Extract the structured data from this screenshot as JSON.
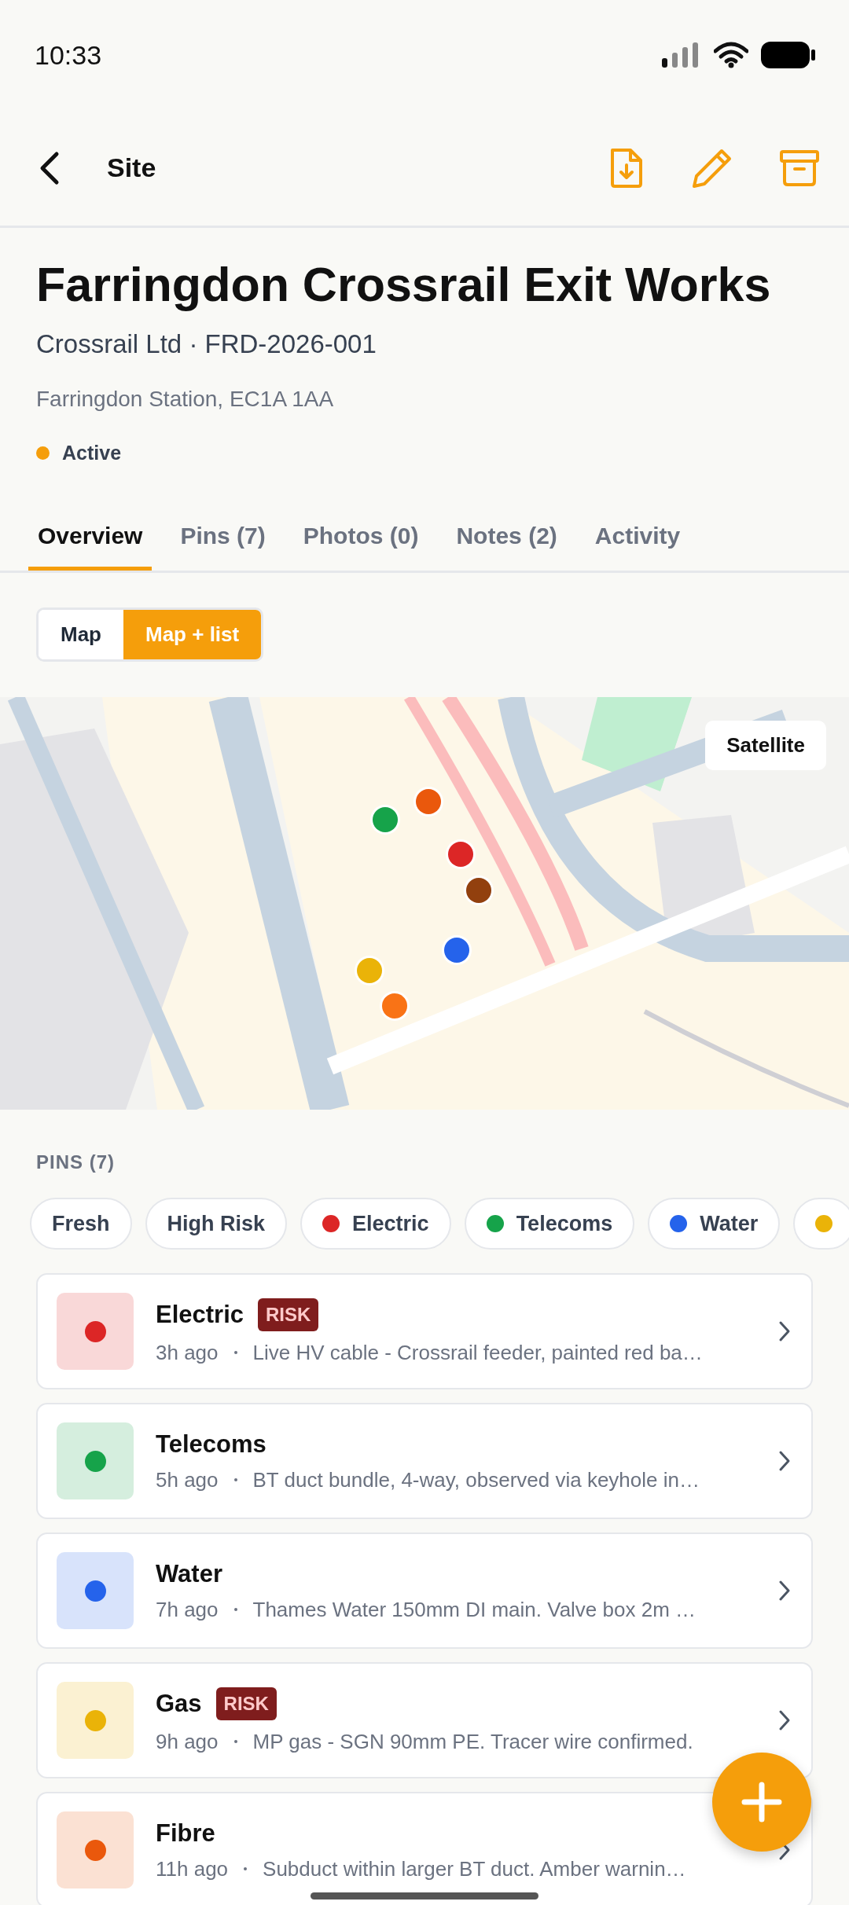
{
  "status_bar": {
    "time": "10:33"
  },
  "header": {
    "title": "Site"
  },
  "site": {
    "name": "Farringdon Crossrail Exit Works",
    "client": "Crossrail Ltd · FRD-2026-001",
    "address": "Farringdon Station, EC1A 1AA",
    "status": "Active"
  },
  "tabs": [
    {
      "label": "Overview",
      "selected": true
    },
    {
      "label": "Pins (7)",
      "selected": false
    },
    {
      "label": "Photos (0)",
      "selected": false
    },
    {
      "label": "Notes (2)",
      "selected": false
    },
    {
      "label": "Activity",
      "selected": false
    }
  ],
  "view_toggle": [
    {
      "label": "Map",
      "selected": false
    },
    {
      "label": "Map + list",
      "selected": true
    }
  ],
  "map": {
    "kind": "picture",
    "satellite_button": "Satellite",
    "markers": [
      {
        "color": "#16a34a"
      },
      {
        "color": "#ea580c"
      },
      {
        "color": "#dc2626"
      },
      {
        "color": "#92400e"
      },
      {
        "color": "#2563eb"
      },
      {
        "color": "#eab308"
      },
      {
        "color": "#f97316"
      }
    ]
  },
  "pins_heading": "PINS (7)",
  "filters": [
    {
      "label": "Fresh"
    },
    {
      "label": "High Risk"
    },
    {
      "label": "Electric",
      "color": "#dc2626"
    },
    {
      "label": "Telecoms",
      "color": "#16a34a"
    },
    {
      "label": "Water",
      "color": "#2563eb"
    },
    {
      "color": "#eab308"
    }
  ],
  "pins": [
    {
      "title": "Electric",
      "risk": "RISK",
      "time": "3h ago",
      "note": "Live HV cable - Crossrail feeder, painted red ba…",
      "color": "#dc2626"
    },
    {
      "title": "Telecoms",
      "time": "5h ago",
      "note": "BT duct bundle, 4-way, observed via keyhole in…",
      "color": "#16a34a"
    },
    {
      "title": "Water",
      "time": "7h ago",
      "note": "Thames Water 150mm DI main. Valve box 2m …",
      "color": "#2563eb"
    },
    {
      "title": "Gas",
      "risk": "RISK",
      "time": "9h ago",
      "note": "MP gas - SGN 90mm PE. Tracer wire confirmed.",
      "color": "#eab308"
    },
    {
      "title": "Fibre",
      "time": "11h ago",
      "note": "Subduct within larger BT duct. Amber warnin…",
      "color": "#ea580c"
    }
  ]
}
